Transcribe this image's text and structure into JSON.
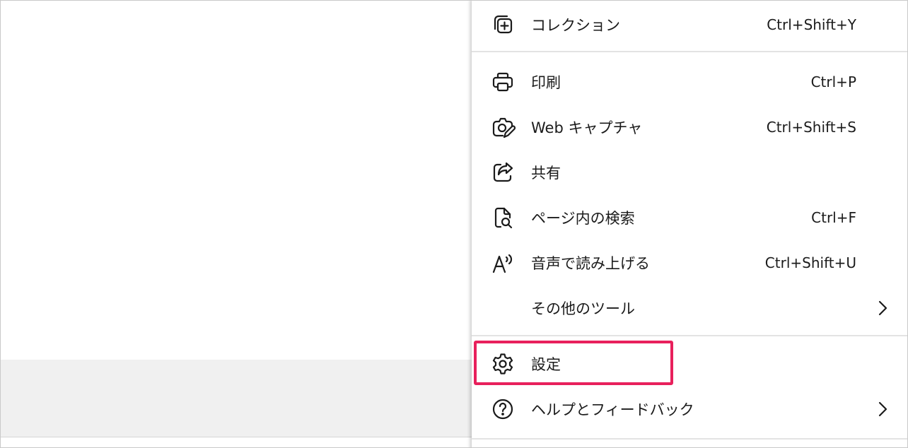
{
  "menu": {
    "items": [
      {
        "label": "コレクション",
        "shortcut": "Ctrl+Shift+Y",
        "icon": "collections-icon"
      },
      {
        "label": "印刷",
        "shortcut": "Ctrl+P",
        "icon": "printer-icon"
      },
      {
        "label": "Web キャプチャ",
        "shortcut": "Ctrl+Shift+S",
        "icon": "web-capture-icon"
      },
      {
        "label": "共有",
        "shortcut": "",
        "icon": "share-icon"
      },
      {
        "label": "ページ内の検索",
        "shortcut": "Ctrl+F",
        "icon": "find-on-page-icon"
      },
      {
        "label": "音声で読み上げる",
        "shortcut": "Ctrl+Shift+U",
        "icon": "read-aloud-icon"
      },
      {
        "label": "その他のツール",
        "shortcut": "",
        "icon": "chevron-right-icon"
      },
      {
        "label": "設定",
        "shortcut": "",
        "icon": "gear-icon"
      },
      {
        "label": "ヘルプとフィードバック",
        "shortcut": "",
        "icon": "help-icon"
      }
    ]
  },
  "colors": {
    "highlight": "#e8205c",
    "text": "#1b1b1b",
    "divider": "#e3e3e3"
  }
}
